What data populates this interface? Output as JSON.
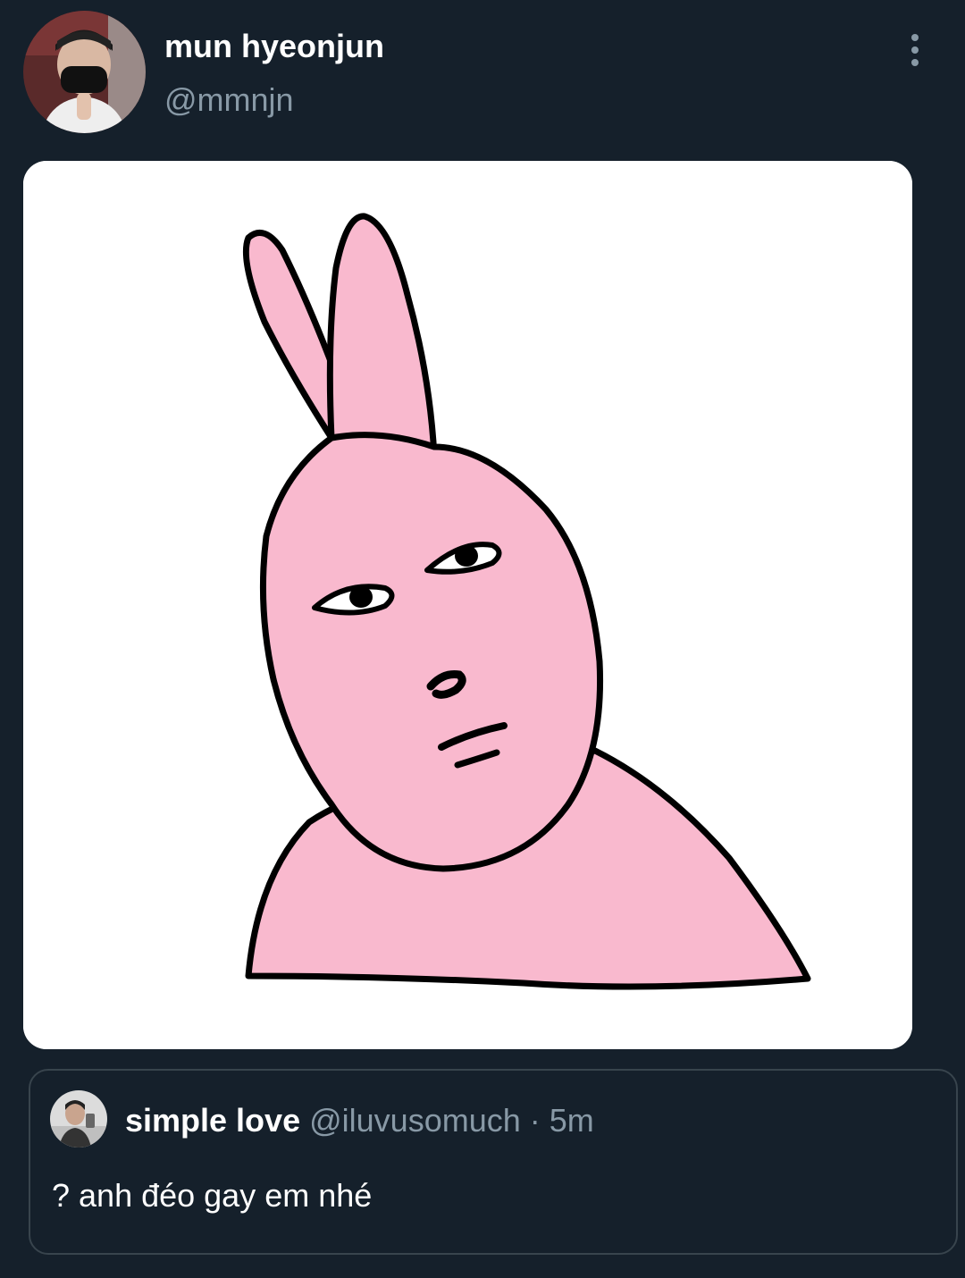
{
  "tweet": {
    "display_name": "mun hyeonjun",
    "handle": "@mmnjn",
    "more_icon": "more-vertical-icon"
  },
  "media": {
    "kind": "pink-rabbit-meme-sticker",
    "colors": {
      "background": "#ffffff",
      "fill": "#f9b9ce",
      "outline": "#000000"
    }
  },
  "quoted_tweet": {
    "display_name": "simple love",
    "handle": "@iluvusomuch",
    "separator": "·",
    "time": "5m",
    "text": "? anh đéo gay em nhé"
  },
  "colors": {
    "background": "#15202b",
    "primary_text": "#ffffff",
    "secondary_text": "#8899a6",
    "border": "#38444d"
  }
}
